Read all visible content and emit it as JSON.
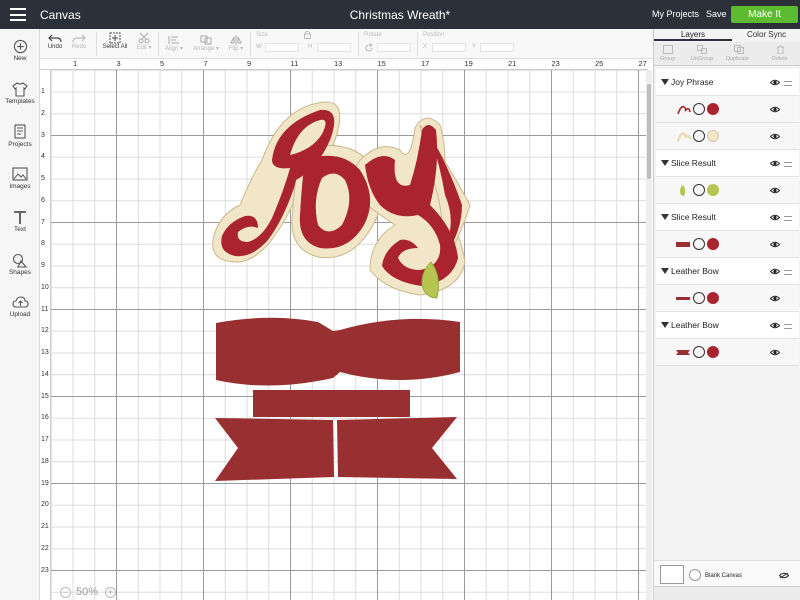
{
  "app": {
    "title": "Canvas",
    "document_title": "Christmas Wreath*"
  },
  "header": {
    "my_projects": "My Projects",
    "save": "Save",
    "make_it": "Make It",
    "make_it_color": "#5dbb2f",
    "bar_color": "#2b3039"
  },
  "sidebar": {
    "items": [
      {
        "label": "New",
        "icon": "plus-circle-icon"
      },
      {
        "label": "Templates",
        "icon": "shirt-icon"
      },
      {
        "label": "Projects",
        "icon": "projects-icon"
      },
      {
        "label": "Images",
        "icon": "image-icon"
      },
      {
        "label": "Text",
        "icon": "text-icon"
      },
      {
        "label": "Shapes",
        "icon": "shapes-icon"
      },
      {
        "label": "Upload",
        "icon": "cloud-upload-icon"
      }
    ]
  },
  "toolbar": {
    "undo": "Undo",
    "redo": "Redo",
    "select_all": "Select All",
    "edit": "Edit",
    "align": "Align",
    "arrange": "Arrange",
    "flip": "Flip",
    "size": "Size",
    "w": "W",
    "h": "H",
    "rotate": "Rotate",
    "position": "Position",
    "x": "X",
    "y": "Y"
  },
  "ruler": {
    "top": [
      "1",
      "3",
      "5",
      "7",
      "9",
      "11",
      "13",
      "15",
      "17",
      "19",
      "21",
      "23",
      "25",
      "27"
    ],
    "left": [
      "1",
      "2",
      "3",
      "4",
      "5",
      "6",
      "7",
      "8",
      "9",
      "10",
      "11",
      "12",
      "13",
      "14",
      "15",
      "16",
      "17",
      "18",
      "19",
      "20",
      "21",
      "22",
      "23"
    ]
  },
  "zoom": {
    "level": "50%"
  },
  "panel": {
    "tabs": [
      "Layers",
      "Color Sync"
    ],
    "tools": [
      "Group",
      "UnGroup",
      "Duplicate",
      "Delete"
    ],
    "groups": [
      {
        "name": "Joy Phrase",
        "layers": [
          {
            "color": "#a9242e"
          },
          {
            "color": "#f1e6c8"
          }
        ]
      },
      {
        "name": "Slice Result",
        "layers": [
          {
            "color": "#b5c550"
          }
        ]
      },
      {
        "name": "Slice Result",
        "layers": [
          {
            "color": "#a9242e"
          }
        ]
      },
      {
        "name": "Leather Bow",
        "layers": [
          {
            "color": "#a9242e"
          }
        ]
      },
      {
        "name": "Leather Bow",
        "layers": [
          {
            "color": "#a9242e"
          }
        ]
      }
    ],
    "blank_canvas": "Blank Canvas"
  },
  "design": {
    "red": "#a9242e",
    "bow_red": "#982f31",
    "cream": "#f1e6c8",
    "green": "#b5c550"
  }
}
